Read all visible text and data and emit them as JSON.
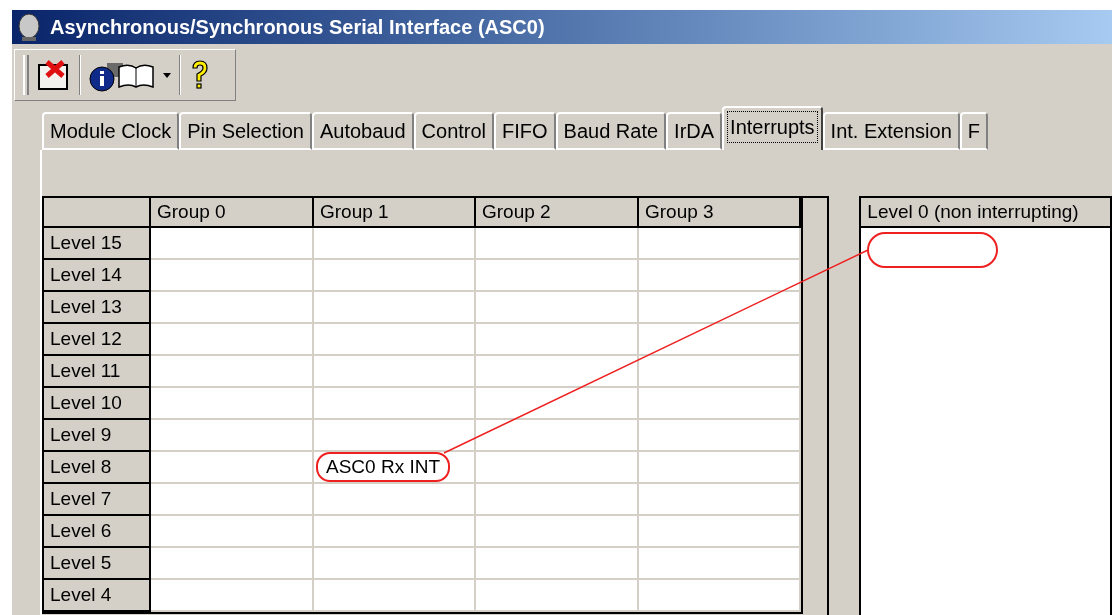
{
  "window": {
    "title": "Asynchronous/Synchronous Serial Interface (ASC0)"
  },
  "tabs": [
    {
      "label": "Module Clock",
      "selected": false
    },
    {
      "label": "Pin Selection",
      "selected": false
    },
    {
      "label": "Autobaud",
      "selected": false
    },
    {
      "label": "Control",
      "selected": false
    },
    {
      "label": "FIFO",
      "selected": false
    },
    {
      "label": "Baud Rate",
      "selected": false
    },
    {
      "label": "IrDA",
      "selected": false
    },
    {
      "label": "Interrupts",
      "selected": true
    },
    {
      "label": "Int. Extension",
      "selected": false
    },
    {
      "label": "F",
      "selected": false
    }
  ],
  "table": {
    "columns": [
      "Group 0",
      "Group 1",
      "Group 2",
      "Group 3"
    ],
    "rows": [
      {
        "label": "Level 15",
        "cells": [
          {},
          {},
          {},
          {}
        ]
      },
      {
        "label": "Level 14",
        "cells": [
          {},
          {},
          {},
          {}
        ]
      },
      {
        "label": "Level 13",
        "cells": [
          {},
          {},
          {},
          {}
        ]
      },
      {
        "label": "Level 12",
        "cells": [
          {},
          {},
          {},
          {}
        ]
      },
      {
        "label": "Level 11",
        "cells": [
          {},
          {},
          {},
          {}
        ]
      },
      {
        "label": "Level 10",
        "cells": [
          {},
          {},
          {},
          {}
        ]
      },
      {
        "label": "Level 9",
        "cells": [
          {},
          {},
          {},
          {}
        ]
      },
      {
        "label": "Level 8",
        "cells": [
          {},
          {
            "text": "ASC0 Rx INT",
            "circled": true
          },
          {},
          {}
        ]
      },
      {
        "label": "Level 7",
        "cells": [
          {},
          {},
          {},
          {}
        ]
      },
      {
        "label": "Level 6",
        "cells": [
          {},
          {},
          {},
          {}
        ]
      },
      {
        "label": "Level 5",
        "cells": [
          {},
          {},
          {},
          {}
        ]
      },
      {
        "label": "Level 4",
        "cells": [
          {},
          {},
          {},
          {}
        ]
      }
    ]
  },
  "level0_list": {
    "header": "Level 0 (non interrupting)",
    "target_marked": true
  }
}
